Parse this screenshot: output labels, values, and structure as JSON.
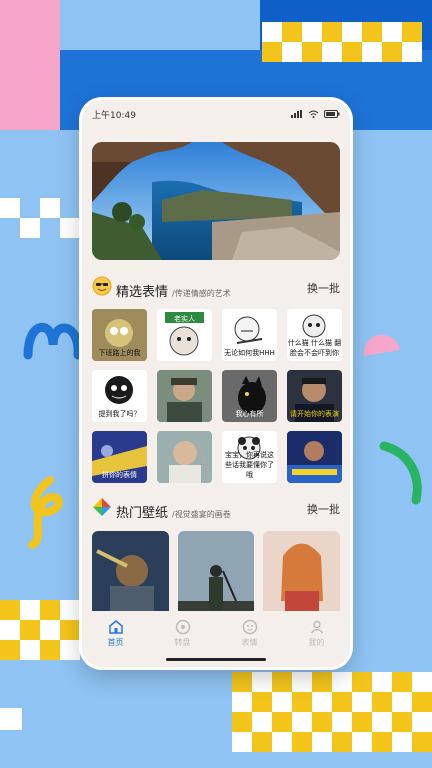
{
  "status_bar": {
    "time": "上午10:49",
    "battery_icon": "battery-icon",
    "wifi_icon": "wifi-icon",
    "signal_icon": "signal-icon"
  },
  "sections": {
    "emoji": {
      "title": "精选表情",
      "subtitle": "/传递情感的艺术",
      "refresh_label": "换一批",
      "items": [
        {
          "caption": "下班路上的我"
        },
        {
          "caption": "老实人"
        },
        {
          "caption": "无论如何我HHH"
        },
        {
          "caption": "什么猫 什么猫 翻脸会不会吓到你"
        },
        {
          "caption": "提到我了吗？"
        },
        {
          "caption": ""
        },
        {
          "caption": "我心有所"
        },
        {
          "caption": "请开始你的表演"
        },
        {
          "caption": "拼你的表情"
        },
        {
          "caption": ""
        },
        {
          "caption": "宝宝，你再说这些话我要懂你了哦"
        },
        {
          "caption": ""
        }
      ]
    },
    "wallpaper": {
      "title": "热门壁纸",
      "subtitle": "/视觉盛宴的画卷",
      "refresh_label": "换一批"
    }
  },
  "tabbar": {
    "tabs": [
      {
        "label": "首页",
        "icon": "home-icon",
        "active": true
      },
      {
        "label": "转盘",
        "icon": "wheel-icon",
        "active": false
      },
      {
        "label": "表情",
        "icon": "emoji-icon",
        "active": false
      },
      {
        "label": "我的",
        "icon": "profile-icon",
        "active": false
      }
    ]
  },
  "colors": {
    "accent": "#1e7be0",
    "background": "#8fc3f3"
  }
}
